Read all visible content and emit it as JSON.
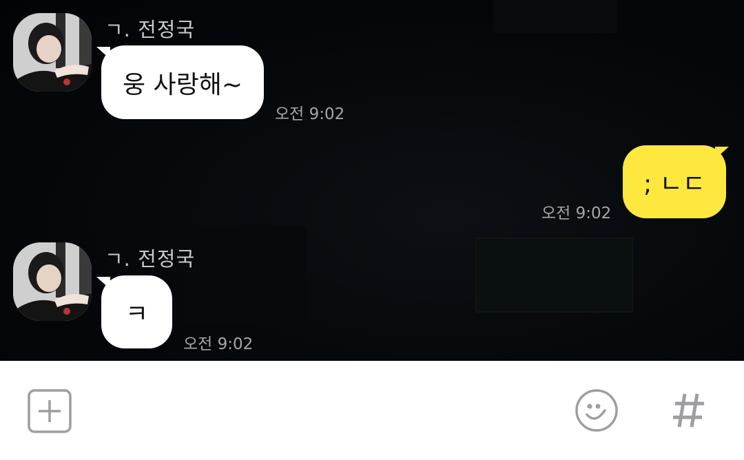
{
  "messages": [
    {
      "sender": "ㄱ. 전정국",
      "text": "웅 사랑해~",
      "time": "오전 9:02",
      "mine": false
    },
    {
      "text": "; ㄴㄷ",
      "time": "오전 9:02",
      "mine": true
    },
    {
      "sender": "ㄱ. 전정국",
      "text": "ㅋ",
      "time": "오전 9:02",
      "mine": false
    }
  ],
  "colors": {
    "my_bubble": "#fee73f",
    "their_bubble": "#ffffff",
    "background": "#05070a",
    "icon_gray": "#9e9ea2"
  },
  "input_bar": {
    "icons": [
      "plus-square-icon",
      "emoji-icon",
      "hashtag-icon"
    ]
  }
}
